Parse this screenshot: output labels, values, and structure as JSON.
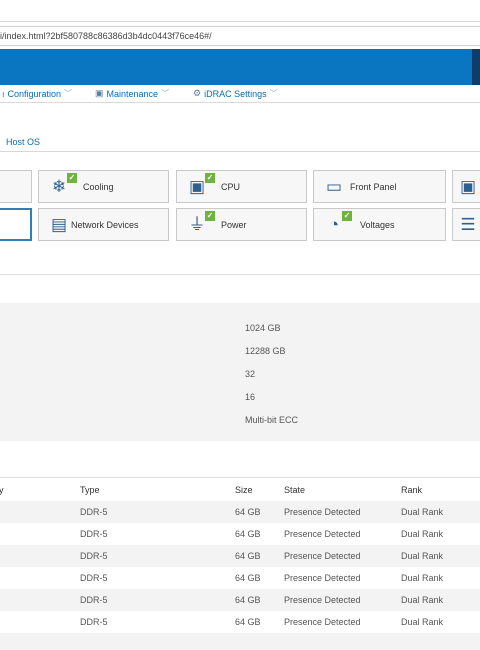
{
  "browser": {
    "url": "i/index.html?2bf580788c86386d3b4dc0443f76ce46#/"
  },
  "colors": {
    "banner": "#0a76c2",
    "accent": "#0a6bb3",
    "status_ok": "#6db33f"
  },
  "menu": [
    {
      "label": "Configuration",
      "icon": "wrench-icon"
    },
    {
      "label": "Maintenance",
      "icon": "calendar-icon"
    },
    {
      "label": "iDRAC Settings",
      "icon": "gears-icon"
    }
  ],
  "tabs": {
    "host_os": "Host OS"
  },
  "tiles": {
    "row1": [
      {
        "label": "Cooling",
        "icon": "snowflake-icon",
        "status": "ok"
      },
      {
        "label": "CPU",
        "icon": "cpu-icon",
        "status": "ok"
      },
      {
        "label": "Front Panel",
        "icon": "front-panel-icon",
        "status": ""
      }
    ],
    "row2": [
      {
        "label": "Network Devices",
        "icon": "network-card-icon",
        "status": ""
      },
      {
        "label": "Power",
        "icon": "power-plug-icon",
        "status": "ok"
      },
      {
        "label": "Voltages",
        "icon": "gauge-icon",
        "status": "ok"
      }
    ]
  },
  "summary": {
    "values": [
      "1024 GB",
      "12288 GB",
      "32",
      "16",
      "Multi-bit ECC"
    ]
  },
  "table": {
    "headers": {
      "slot": "y",
      "type": "Type",
      "size": "Size",
      "state": "State",
      "rank": "Rank"
    },
    "rows": [
      {
        "type": "DDR-5",
        "size": "64 GB",
        "state": "Presence Detected",
        "rank": "Dual Rank"
      },
      {
        "type": "DDR-5",
        "size": "64 GB",
        "state": "Presence Detected",
        "rank": "Dual Rank"
      },
      {
        "type": "DDR-5",
        "size": "64 GB",
        "state": "Presence Detected",
        "rank": "Dual Rank"
      },
      {
        "type": "DDR-5",
        "size": "64 GB",
        "state": "Presence Detected",
        "rank": "Dual Rank"
      },
      {
        "type": "DDR-5",
        "size": "64 GB",
        "state": "Presence Detected",
        "rank": "Dual Rank"
      },
      {
        "type": "DDR-5",
        "size": "64 GB",
        "state": "Presence Detected",
        "rank": "Dual Rank"
      }
    ]
  }
}
